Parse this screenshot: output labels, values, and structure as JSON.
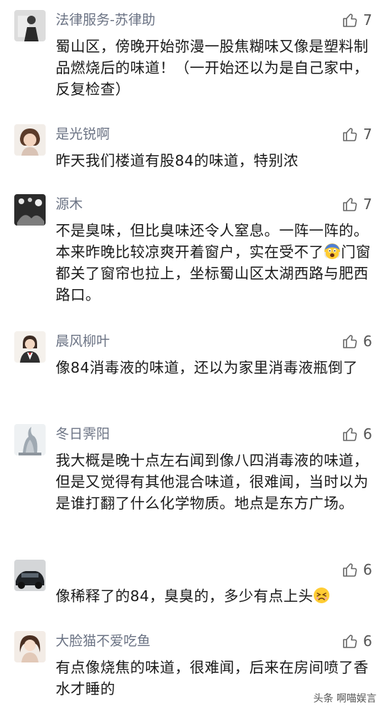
{
  "comments": [
    {
      "username": "法律服务-苏律助",
      "likes": "7",
      "text": "蜀山区，傍晚开始弥漫一股焦糊味又像是塑料制品燃烧后的味道！（一开始还以为是自己家中，反复检查）"
    },
    {
      "username": "是光锐啊",
      "likes": "7",
      "text": "昨天我们楼道有股84的味道，特别浓"
    },
    {
      "username": "源木",
      "likes": "7",
      "text_before": "不是臭味，但比臭味还令人窒息。一阵一阵的。本来昨晚比较凉爽开着窗户，实在受不了",
      "emoji": "fearful-face-emoji",
      "text_after": "门窗都关了窗帘也拉上，坐标蜀山区太湖西路与肥西路口。"
    },
    {
      "username": "晨风柳叶",
      "likes": "6",
      "text": "像84消毒液的味道，还以为家里消毒液瓶倒了"
    },
    {
      "username": "冬日霁阳",
      "likes": "6",
      "text": "我大概是晚十点左右闻到像八四消毒液的味道，但是又觉得有其他混合味道，很难闻，当时以为是谁打翻了什么化学物质。地点是东方广场。"
    },
    {
      "username": "",
      "likes": "6",
      "text_before": "像稀释了的84，臭臭的，多少有点上头",
      "emoji": "tired-face-emoji"
    },
    {
      "username": "大脸猫不爱吃鱼",
      "likes": "6",
      "text": "有点像烧焦的味道，很难闻，后来在房间喷了香水才睡的"
    }
  ],
  "watermark": "头条 啊喵娱言",
  "colors": {
    "username": "#6b7384",
    "text": "#1a1a1a",
    "icon": "#666666"
  }
}
